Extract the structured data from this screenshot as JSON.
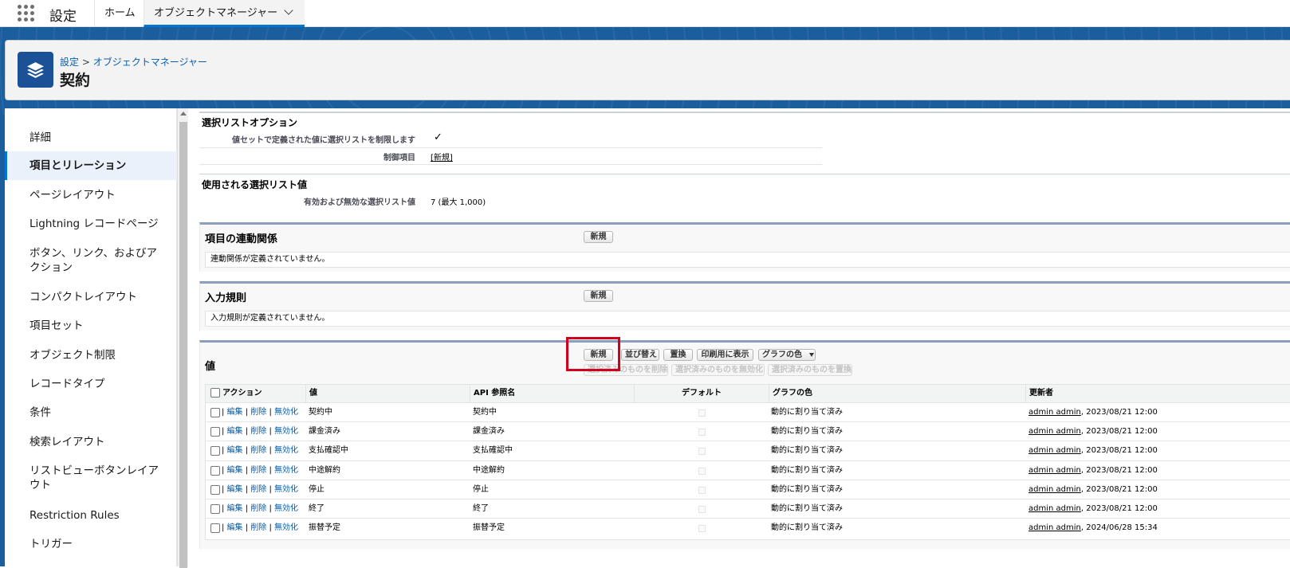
{
  "topbar": {
    "app_name": "設定",
    "tabs": [
      {
        "label": "ホーム"
      },
      {
        "label": "オブジェクトマネージャー"
      }
    ]
  },
  "header": {
    "breadcrumb": {
      "root": "設定",
      "separator": ">",
      "current": "オブジェクトマネージャー"
    },
    "title": "契約",
    "icon": "layers-icon"
  },
  "sidebar": {
    "items": [
      {
        "label": "詳細"
      },
      {
        "label": "項目とリレーション"
      },
      {
        "label": "ページレイアウト"
      },
      {
        "label": "Lightning レコードページ"
      },
      {
        "label": "ボタン、リンク、およびア\nクション"
      },
      {
        "label": "コンパクトレイアウト"
      },
      {
        "label": "項目セット"
      },
      {
        "label": "オブジェクト制限"
      },
      {
        "label": "レコードタイプ"
      },
      {
        "label": "条件"
      },
      {
        "label": "検索レイアウト"
      },
      {
        "label": "リストビューボタンレイア\nウト"
      },
      {
        "label": "Restriction Rules"
      },
      {
        "label": "トリガー"
      }
    ]
  },
  "picklist_options": {
    "heading": "選択リストオプション",
    "restrict_label": "値セットで定義された値に選択リストを制限します",
    "restrict_value": "✓",
    "controlling_label": "制御項目",
    "controlling_value": "[新規]"
  },
  "used_values": {
    "heading": "使用される選択リスト値",
    "label": "有効および無効な選択リスト値",
    "value": "7 (最大 1,000)"
  },
  "dependencies": {
    "title": "項目の連動関係",
    "new_button": "新規",
    "empty": "連動関係が定義されていません。"
  },
  "validation": {
    "title": "入力規則",
    "new_button": "新規",
    "empty": "入力規則が定義されていません。"
  },
  "values": {
    "title": "値",
    "buttons": {
      "new": "新規",
      "reorder": "並び替え",
      "replace": "置換",
      "print": "印刷用に表示",
      "chart_color": "グラフの色"
    },
    "disabled_buttons": {
      "delete_selected": "選択済みのものを削除",
      "deactivate_selected": "選択済みのものを無効化",
      "replace_selected": "選択済みのものを置換"
    },
    "columns": {
      "action": "アクション",
      "value": "値",
      "api_name": "API 参照名",
      "default": "デフォルト",
      "chart_color": "グラフの色",
      "modified_by": "更新者"
    },
    "action_links": {
      "edit": "編集",
      "delete": "削除",
      "deactivate": "無効化",
      "sep": "|"
    },
    "rows": [
      {
        "value": "契約中",
        "api": "契約中",
        "color": "動的に割り当て済み",
        "user": "admin admin",
        "date": ", 2023/08/21 12:00"
      },
      {
        "value": "課金済み",
        "api": "課金済み",
        "color": "動的に割り当て済み",
        "user": "admin admin",
        "date": ", 2023/08/21 12:00"
      },
      {
        "value": "支払確認中",
        "api": "支払確認中",
        "color": "動的に割り当て済み",
        "user": "admin admin",
        "date": ", 2023/08/21 12:00"
      },
      {
        "value": "中途解約",
        "api": "中途解約",
        "color": "動的に割り当て済み",
        "user": "admin admin",
        "date": ", 2023/08/21 12:00"
      },
      {
        "value": "停止",
        "api": "停止",
        "color": "動的に割り当て済み",
        "user": "admin admin",
        "date": ", 2023/08/21 12:00"
      },
      {
        "value": "終了",
        "api": "終了",
        "color": "動的に割り当て済み",
        "user": "admin admin",
        "date": ", 2023/08/21 12:00"
      },
      {
        "value": "振替予定",
        "api": "振替予定",
        "color": "動的に割り当て済み",
        "user": "admin admin",
        "date": ", 2024/06/28 15:34"
      }
    ]
  },
  "colors": {
    "accent": "#0176d3",
    "band": "#1b5e9d",
    "highlight": "#d0021b",
    "link": "#015ba7"
  }
}
